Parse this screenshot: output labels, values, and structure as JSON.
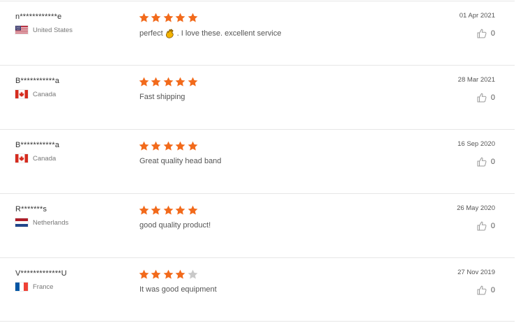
{
  "reviews": [
    {
      "user": "n************e",
      "country": "United States",
      "flag": "us-flag-icon",
      "rating": 5,
      "text_before": "perfect",
      "emoji": "hand-emoji-icon",
      "text_after": ".  I love these. excellent service",
      "date": "01 Apr 2021",
      "helpful_count": "0"
    },
    {
      "user": "B***********a",
      "country": "Canada",
      "flag": "canada-flag-icon",
      "rating": 5,
      "text_before": "Fast shipping",
      "emoji": null,
      "text_after": "",
      "date": "28 Mar 2021",
      "helpful_count": "0"
    },
    {
      "user": "B***********a",
      "country": "Canada",
      "flag": "canada-flag-icon",
      "rating": 5,
      "text_before": "Great quality head band",
      "emoji": null,
      "text_after": "",
      "date": "16 Sep 2020",
      "helpful_count": "0"
    },
    {
      "user": "R*******s",
      "country": "Netherlands",
      "flag": "netherlands-flag-icon",
      "rating": 5,
      "text_before": "good quality product!",
      "emoji": null,
      "text_after": "",
      "date": "26 May 2020",
      "helpful_count": "0"
    },
    {
      "user": "V*************U",
      "country": "France",
      "flag": "france-flag-icon",
      "rating": 4,
      "text_before": "It was good equipment",
      "emoji": null,
      "text_after": "",
      "date": "27 Nov 2019",
      "helpful_count": "0"
    }
  ],
  "colors": {
    "star_filled": "#f26a1b",
    "star_empty": "#c9c9c9",
    "divider": "#e6e6e6"
  },
  "icons": {
    "star": "star-icon",
    "thumb": "thumbs-up-icon"
  }
}
